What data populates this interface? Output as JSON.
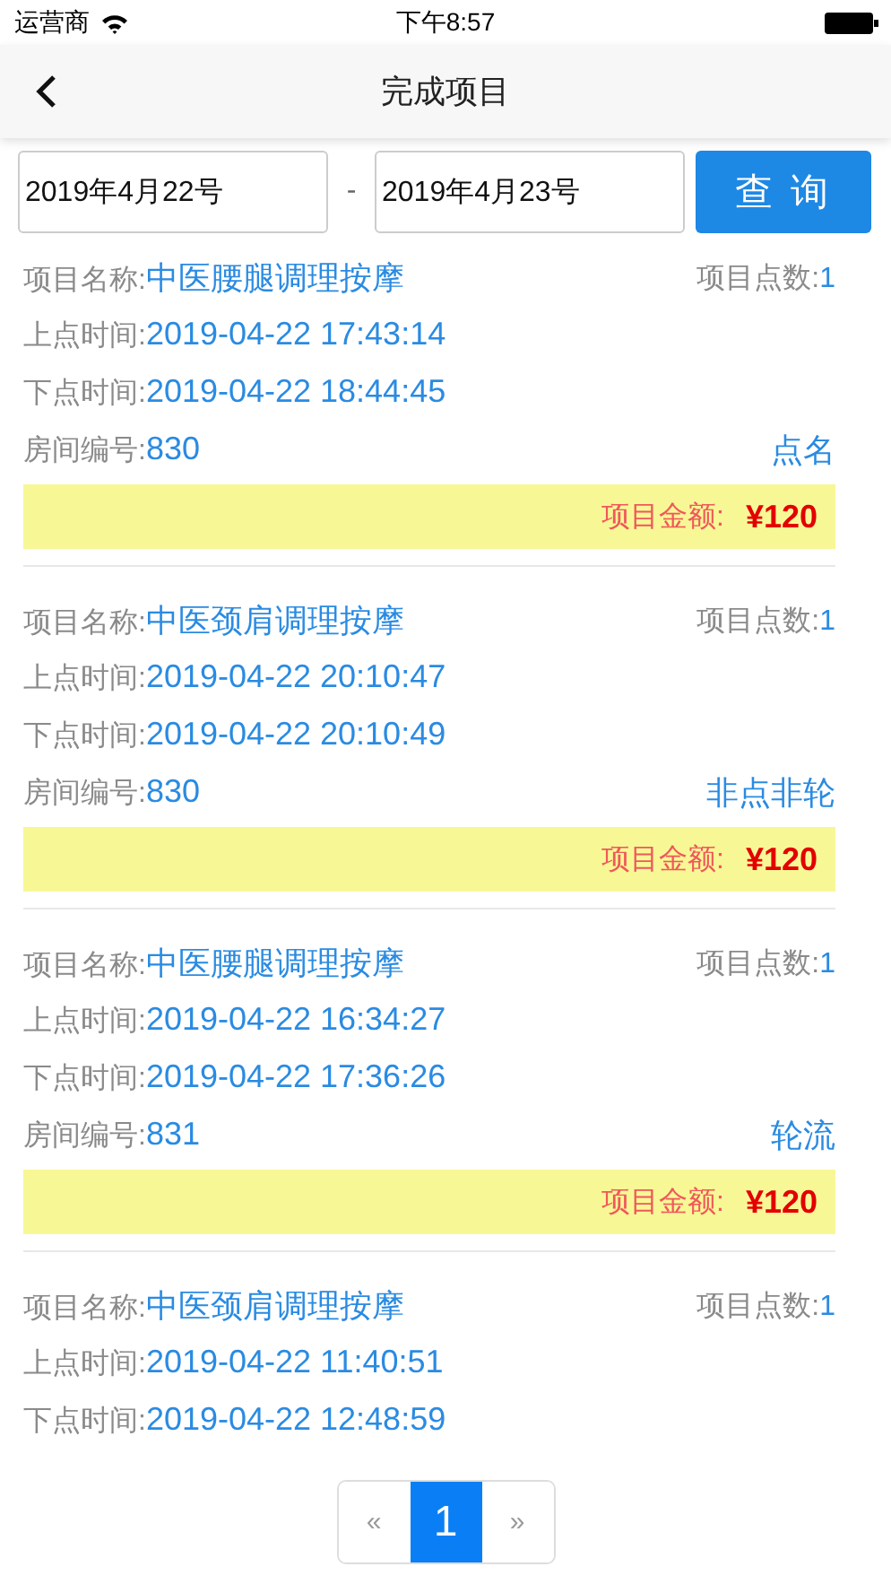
{
  "status_bar": {
    "carrier": "运营商",
    "time": "下午8:57"
  },
  "nav": {
    "title": "完成项目"
  },
  "filter": {
    "start_date": "2019年4月22号",
    "separator": "-",
    "end_date": "2019年4月23号",
    "button": "查 询"
  },
  "records": [
    {
      "name_label": "项目名称:",
      "name": "中医腰腿调理按摩",
      "points_label": "项目点数:",
      "points": "1",
      "start_label": "上点时间:",
      "start": "2019-04-22 17:43:14",
      "end_label": "下点时间:",
      "end": "2019-04-22 18:44:45",
      "room_label": "房间编号:",
      "room": "830",
      "type": "点名",
      "amount_label": "项目金额:",
      "amount": "¥120"
    },
    {
      "name_label": "项目名称:",
      "name": "中医颈肩调理按摩",
      "points_label": "项目点数:",
      "points": "1",
      "start_label": "上点时间:",
      "start": "2019-04-22 20:10:47",
      "end_label": "下点时间:",
      "end": "2019-04-22 20:10:49",
      "room_label": "房间编号:",
      "room": "830",
      "type": "非点非轮",
      "amount_label": "项目金额:",
      "amount": "¥120"
    },
    {
      "name_label": "项目名称:",
      "name": "中医腰腿调理按摩",
      "points_label": "项目点数:",
      "points": "1",
      "start_label": "上点时间:",
      "start": "2019-04-22 16:34:27",
      "end_label": "下点时间:",
      "end": "2019-04-22 17:36:26",
      "room_label": "房间编号:",
      "room": "831",
      "type": "轮流",
      "amount_label": "项目金额:",
      "amount": "¥120"
    },
    {
      "name_label": "项目名称:",
      "name": "中医颈肩调理按摩",
      "points_label": "项目点数:",
      "points": "1",
      "start_label": "上点时间:",
      "start": "2019-04-22 11:40:51",
      "end_label": "下点时间:",
      "end": "2019-04-22 12:48:59"
    }
  ],
  "pagination": [
    {
      "kind": "prev",
      "label": "«",
      "selected": false
    },
    {
      "kind": "page",
      "label": "1",
      "selected": true
    },
    {
      "kind": "next",
      "label": "»",
      "selected": false
    }
  ]
}
